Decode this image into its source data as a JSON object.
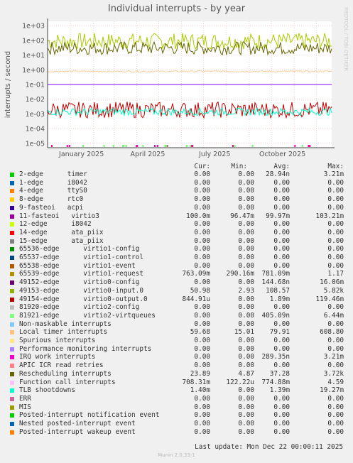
{
  "chart_data": {
    "type": "line",
    "title": "Individual interrupts - by year",
    "ylabel": "interrupts / second",
    "yscale": "log",
    "ylim": [
      5e-06,
      2000
    ],
    "y_ticks": [
      "1e+03",
      "1e+02",
      "1e+01",
      "1e+00",
      "1e-01",
      "1e-02",
      "1e-03",
      "1e-04",
      "1e-05"
    ],
    "x_ticks": [
      "January 2025",
      "April 2025",
      "July 2025",
      "October 2025"
    ],
    "x_range": [
      "2024-12-01",
      "2025-12-22"
    ],
    "grid": true,
    "watermark": "RRDTOOL / TOBI OETIKER",
    "series": [
      {
        "name": "Local timer interrupts",
        "color": "#aacc00",
        "approx_level": 90
      },
      {
        "name": "Rescheduling interrupts",
        "color": "#666600",
        "approx_level": 30
      },
      {
        "name": "Function call interrupts",
        "color": "#ffcc99",
        "approx_level": 0.78
      },
      {
        "name": "11-fasteoi virtio3",
        "color": "#8000ff",
        "approx_level": 0.1
      },
      {
        "name": "49154-edge virtio0-output.0",
        "color": "#bb0000",
        "approx_level": 0.0019
      },
      {
        "name": "TLB shootdowns",
        "color": "#00ffcc",
        "approx_level": 0.0014
      },
      {
        "name": "IRQ work interrupts",
        "color": "#ff0099",
        "approx_level": 1e-05
      },
      {
        "name": "81921-edge virtio2-virtqueues",
        "color": "#66ff66",
        "approx_level": 1e-05
      }
    ]
  },
  "legend": {
    "headers": {
      "cur": "Cur:",
      "min": "Min:",
      "avg": "Avg:",
      "max": "Max:"
    },
    "rows": [
      {
        "name": "2-edge      timer",
        "color": "#00cc00",
        "cur": "0.00",
        "min": "0.00",
        "avg": "28.94n",
        "max": "3.21m"
      },
      {
        "name": "1-edge      i8042",
        "color": "#0066b3",
        "cur": "0.00",
        "min": "0.00",
        "avg": "0.00",
        "max": "0.00"
      },
      {
        "name": "4-edge      ttyS0",
        "color": "#ff8000",
        "cur": "0.00",
        "min": "0.00",
        "avg": "0.00",
        "max": "0.00"
      },
      {
        "name": "8-edge      rtc0",
        "color": "#ffcc00",
        "cur": "0.00",
        "min": "0.00",
        "avg": "0.00",
        "max": "0.00"
      },
      {
        "name": "9-fasteoi   acpi",
        "color": "#330099",
        "cur": "0.00",
        "min": "0.00",
        "avg": "0.00",
        "max": "0.00"
      },
      {
        "name": "11-fasteoi   virtio3",
        "color": "#990099",
        "cur": "100.0m",
        "min": "96.47m",
        "avg": "99.97m",
        "max": "103.21m"
      },
      {
        "name": "12-edge      i8042",
        "color": "#ccff00",
        "cur": "0.00",
        "min": "0.00",
        "avg": "0.00",
        "max": "0.00"
      },
      {
        "name": "14-edge      ata_piix",
        "color": "#ff0000",
        "cur": "0.00",
        "min": "0.00",
        "avg": "0.00",
        "max": "0.00"
      },
      {
        "name": "15-edge      ata_piix",
        "color": "#808080",
        "cur": "0.00",
        "min": "0.00",
        "avg": "0.00",
        "max": "0.00"
      },
      {
        "name": "65536-edge      virtio1-config",
        "color": "#008f00",
        "cur": "0.00",
        "min": "0.00",
        "avg": "0.00",
        "max": "0.00"
      },
      {
        "name": "65537-edge      virtio1-control",
        "color": "#00487d",
        "cur": "0.00",
        "min": "0.00",
        "avg": "0.00",
        "max": "0.00"
      },
      {
        "name": "65538-edge      virtio1-event",
        "color": "#b35a00",
        "cur": "0.00",
        "min": "0.00",
        "avg": "0.00",
        "max": "0.00"
      },
      {
        "name": "65539-edge      virtio1-request",
        "color": "#b38f00",
        "cur": "763.09m",
        "min": "290.16m",
        "avg": "781.09m",
        "max": "1.17"
      },
      {
        "name": "49152-edge      virtio0-config",
        "color": "#6b006b",
        "cur": "0.00",
        "min": "0.00",
        "avg": "144.68n",
        "max": "16.06m"
      },
      {
        "name": "49153-edge      virtio0-input.0",
        "color": "#8fb300",
        "cur": "50.98",
        "min": "2.93",
        "avg": "108.57",
        "max": "5.82k"
      },
      {
        "name": "49154-edge      virtio0-output.0",
        "color": "#b30000",
        "cur": "844.91u",
        "min": "0.00",
        "avg": "1.89m",
        "max": "119.46m"
      },
      {
        "name": "81920-edge      virtio2-config",
        "color": "#bebebe",
        "cur": "0.00",
        "min": "0.00",
        "avg": "0.00",
        "max": "0.00"
      },
      {
        "name": "81921-edge      virtio2-virtqueues",
        "color": "#80ff80",
        "cur": "0.00",
        "min": "0.00",
        "avg": "405.09n",
        "max": "6.44m"
      },
      {
        "name": "Non-maskable interrupts",
        "color": "#80c9ff",
        "cur": "0.00",
        "min": "0.00",
        "avg": "0.00",
        "max": "0.00"
      },
      {
        "name": "Local timer interrupts",
        "color": "#ffc080",
        "cur": "59.68",
        "min": "15.01",
        "avg": "79.91",
        "max": "608.80"
      },
      {
        "name": "Spurious interrupts",
        "color": "#ffe680",
        "cur": "0.00",
        "min": "0.00",
        "avg": "0.00",
        "max": "0.00"
      },
      {
        "name": "Performance monitoring interrupts",
        "color": "#aa80ff",
        "cur": "0.00",
        "min": "0.00",
        "avg": "0.00",
        "max": "0.00"
      },
      {
        "name": "IRQ work interrupts",
        "color": "#ee00cc",
        "cur": "0.00",
        "min": "0.00",
        "avg": "289.35n",
        "max": "3.21m"
      },
      {
        "name": "APIC ICR read retries",
        "color": "#ff8080",
        "cur": "0.00",
        "min": "0.00",
        "avg": "0.00",
        "max": "0.00"
      },
      {
        "name": "Rescheduling interrupts",
        "color": "#666600",
        "cur": "23.89",
        "min": "4.87",
        "avg": "37.28",
        "max": "3.72k"
      },
      {
        "name": "Function call interrupts",
        "color": "#ffbfff",
        "cur": "708.31m",
        "min": "122.22u",
        "avg": "774.88m",
        "max": "4.59"
      },
      {
        "name": "TLB shootdowns",
        "color": "#00ffcc",
        "cur": "1.40m",
        "min": "0.00",
        "avg": "1.39m",
        "max": "19.27m"
      },
      {
        "name": "ERR",
        "color": "#cc6699",
        "cur": "0.00",
        "min": "0.00",
        "avg": "0.00",
        "max": "0.00"
      },
      {
        "name": "MIS",
        "color": "#999900",
        "cur": "0.00",
        "min": "0.00",
        "avg": "0.00",
        "max": "0.00"
      },
      {
        "name": "Posted-interrupt notification event",
        "color": "#00cc00",
        "cur": "0.00",
        "min": "0.00",
        "avg": "0.00",
        "max": "0.00"
      },
      {
        "name": "Nested posted-interrupt event",
        "color": "#0066b3",
        "cur": "0.00",
        "min": "0.00",
        "avg": "0.00",
        "max": "0.00"
      },
      {
        "name": "Posted-interrupt wakeup event",
        "color": "#ff8000",
        "cur": "0.00",
        "min": "0.00",
        "avg": "0.00",
        "max": "0.00"
      }
    ]
  },
  "footer": {
    "last_update": "Last update:  Mon Dec 22 00:00:11 2025",
    "version": "Munin 2.0.33-1"
  }
}
